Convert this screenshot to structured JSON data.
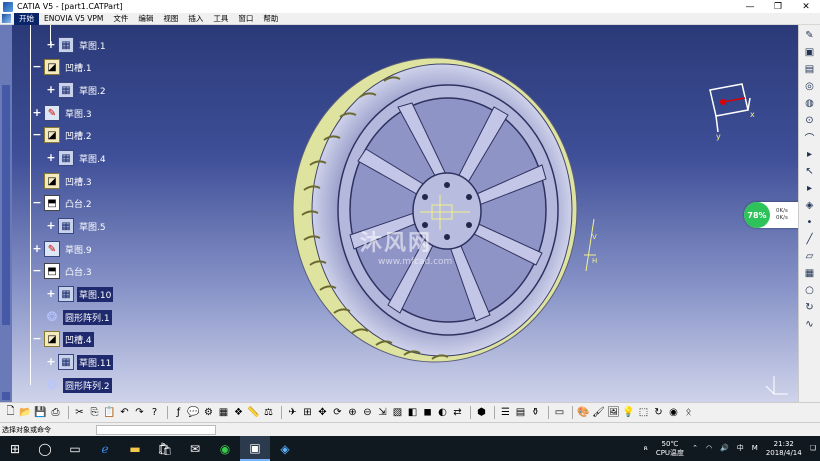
{
  "window": {
    "title": "CATIA V5 - [part1.CATPart]",
    "minimize": "—",
    "restore": "❐",
    "close": "✕"
  },
  "menu": [
    "开始",
    "ENOVIA V5 VPM",
    "文件",
    "编辑",
    "视图",
    "插入",
    "工具",
    "窗口",
    "帮助"
  ],
  "tree": [
    {
      "label": "草图.1",
      "icon": "sketch",
      "highlighted": false
    },
    {
      "label": "凹槽.1",
      "icon": "pocket",
      "highlighted": false
    },
    {
      "label": "草图.2",
      "icon": "sketch",
      "highlighted": false
    },
    {
      "label": "草图.3",
      "icon": "sketch-plain",
      "highlighted": false
    },
    {
      "label": "凹槽.2",
      "icon": "pocket",
      "highlighted": false
    },
    {
      "label": "草图.4",
      "icon": "sketch",
      "highlighted": false
    },
    {
      "label": "凹槽.3",
      "icon": "pocket",
      "highlighted": false
    },
    {
      "label": "凸台.2",
      "icon": "pad",
      "highlighted": false
    },
    {
      "label": "草图.5",
      "icon": "sketch",
      "highlighted": false
    },
    {
      "label": "草图.9",
      "icon": "sketch-plain",
      "highlighted": false
    },
    {
      "label": "凸台.3",
      "icon": "pad",
      "highlighted": false
    },
    {
      "label": "草图.10",
      "icon": "sketch",
      "highlighted": true
    },
    {
      "label": "圆形阵列.1",
      "icon": "pattern",
      "highlighted": true
    },
    {
      "label": "凹槽.4",
      "icon": "pocket",
      "highlighted": true
    },
    {
      "label": "草图.11",
      "icon": "sketch",
      "highlighted": true
    },
    {
      "label": "圆形阵列.2",
      "icon": "pattern",
      "highlighted": true
    }
  ],
  "watermark": {
    "text": "沐风网",
    "url": "www.mfcad.com"
  },
  "compass": {
    "x_label": "x",
    "y_label": "y"
  },
  "axis_small": {
    "v_label": "V",
    "h_label": "H"
  },
  "perf": {
    "percent": "78%",
    "up": "0K/s",
    "down": "0K/s",
    "plus": "+"
  },
  "status": {
    "text": "选择对象或命令"
  },
  "taskbar": {
    "temp": "50℃",
    "temp_label": "CPU温度",
    "time": "21:32",
    "date": "2018/4/14",
    "ime": "中",
    "ime2": "M",
    "notify": "❏"
  },
  "colors": {
    "viewport_top": "#2a3a78",
    "viewport_bottom": "#cfd3ea",
    "tire": "#b8bcd8",
    "tread": "#e3e6a0",
    "rim": "#8d92c4"
  }
}
